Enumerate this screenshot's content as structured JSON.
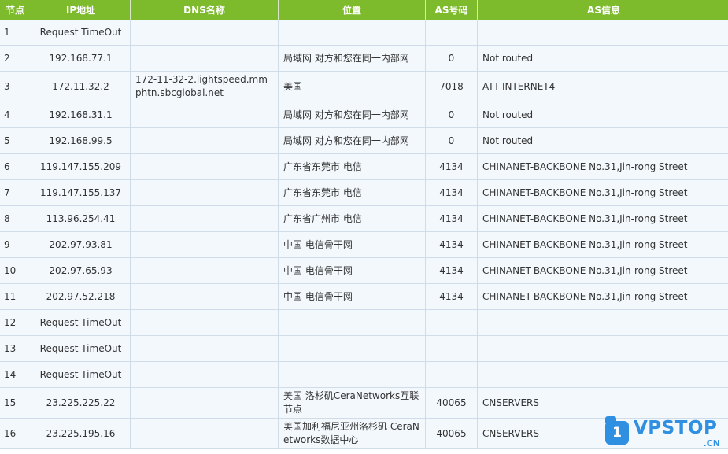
{
  "table": {
    "headers": [
      "节点",
      "IP地址",
      "DNS名称",
      "位置",
      "AS号码",
      "AS信息"
    ],
    "rows": [
      {
        "hop": "1",
        "ip": "Request TimeOut",
        "dns": "",
        "location": "",
        "asn": "",
        "as_info": ""
      },
      {
        "hop": "2",
        "ip": "192.168.77.1",
        "dns": "",
        "location": "局域网 对方和您在同一内部网",
        "asn": "0",
        "as_info": "Not routed"
      },
      {
        "hop": "3",
        "ip": "172.11.32.2",
        "dns": "172-11-32-2.lightspeed.mmphtn.sbcglobal.net",
        "location": "美国",
        "asn": "7018",
        "as_info": "ATT-INTERNET4"
      },
      {
        "hop": "4",
        "ip": "192.168.31.1",
        "dns": "",
        "location": "局域网 对方和您在同一内部网",
        "asn": "0",
        "as_info": "Not routed"
      },
      {
        "hop": "5",
        "ip": "192.168.99.5",
        "dns": "",
        "location": "局域网 对方和您在同一内部网",
        "asn": "0",
        "as_info": "Not routed"
      },
      {
        "hop": "6",
        "ip": "119.147.155.209",
        "dns": "",
        "location": "广东省东莞市 电信",
        "asn": "4134",
        "as_info": "CHINANET-BACKBONE No.31,Jin-rong Street"
      },
      {
        "hop": "7",
        "ip": "119.147.155.137",
        "dns": "",
        "location": "广东省东莞市 电信",
        "asn": "4134",
        "as_info": "CHINANET-BACKBONE No.31,Jin-rong Street"
      },
      {
        "hop": "8",
        "ip": "113.96.254.41",
        "dns": "",
        "location": "广东省广州市 电信",
        "asn": "4134",
        "as_info": "CHINANET-BACKBONE No.31,Jin-rong Street"
      },
      {
        "hop": "9",
        "ip": "202.97.93.81",
        "dns": "",
        "location": "中国 电信骨干网",
        "asn": "4134",
        "as_info": "CHINANET-BACKBONE No.31,Jin-rong Street"
      },
      {
        "hop": "10",
        "ip": "202.97.65.93",
        "dns": "",
        "location": "中国 电信骨干网",
        "asn": "4134",
        "as_info": "CHINANET-BACKBONE No.31,Jin-rong Street"
      },
      {
        "hop": "11",
        "ip": "202.97.52.218",
        "dns": "",
        "location": "中国 电信骨干网",
        "asn": "4134",
        "as_info": "CHINANET-BACKBONE No.31,Jin-rong Street"
      },
      {
        "hop": "12",
        "ip": "Request TimeOut",
        "dns": "",
        "location": "",
        "asn": "",
        "as_info": ""
      },
      {
        "hop": "13",
        "ip": "Request TimeOut",
        "dns": "",
        "location": "",
        "asn": "",
        "as_info": ""
      },
      {
        "hop": "14",
        "ip": "Request TimeOut",
        "dns": "",
        "location": "",
        "asn": "",
        "as_info": ""
      },
      {
        "hop": "15",
        "ip": "23.225.225.22",
        "dns": "",
        "location": "美国 洛杉矶CeraNetworks互联节点",
        "asn": "40065",
        "as_info": "CNSERVERS"
      },
      {
        "hop": "16",
        "ip": "23.225.195.16",
        "dns": "",
        "location": "美国加利福尼亚州洛杉矶 CeraNetworks数据中心",
        "asn": "40065",
        "as_info": "CNSERVERS"
      }
    ]
  },
  "watermark": {
    "badge_text": "1",
    "brand": "VPSTOP",
    "tld": ".CN",
    "color": "#2f8fe0"
  },
  "colors": {
    "header_bg": "#7dbb2c",
    "row_bg": "#f3f8fc"
  }
}
